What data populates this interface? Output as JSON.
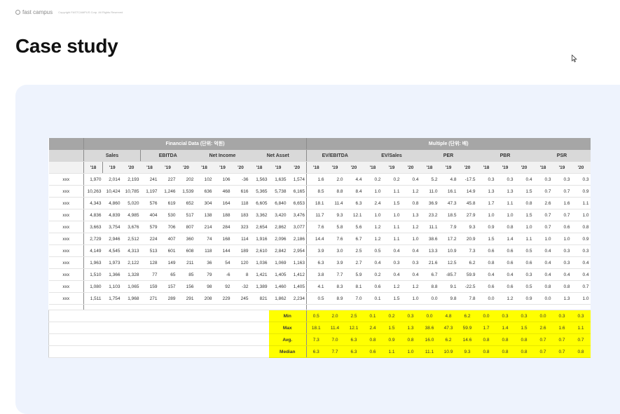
{
  "header": {
    "brand": "fast campus",
    "copyright": "Copyright FASTCAMPUS Corp. All Rights Reserved"
  },
  "page": {
    "title": "Case study"
  },
  "table": {
    "group_headers": {
      "financial": "Financial Data (단위: 억원)",
      "multiple": "Multiple (단위: 배)"
    },
    "metric_headers": [
      "Sales",
      "EBITDA",
      "Net Income",
      "Net Asset",
      "EV/EBITDA",
      "EV/Sales",
      "PER",
      "PBR",
      "PSR"
    ],
    "years": [
      "'18",
      "'19",
      "'20"
    ],
    "rows": [
      {
        "label": "xxx",
        "values": [
          "1,970",
          "2,014",
          "2,193",
          "241",
          "227",
          "202",
          "102",
          "106",
          "-36",
          "1,563",
          "1,635",
          "1,574",
          "1.6",
          "2.0",
          "4.4",
          "0.2",
          "0.2",
          "0.4",
          "5.2",
          "4.8",
          "-17.5",
          "0.3",
          "0.3",
          "0.4",
          "0.3",
          "0.3",
          "0.3"
        ]
      },
      {
        "label": "xxx",
        "values": [
          "10,263",
          "10,424",
          "10,785",
          "1,197",
          "1,246",
          "1,539",
          "636",
          "468",
          "616",
          "5,365",
          "5,738",
          "6,165",
          "8.5",
          "8.8",
          "8.4",
          "1.0",
          "1.1",
          "1.2",
          "11.0",
          "16.1",
          "14.9",
          "1.3",
          "1.3",
          "1.5",
          "0.7",
          "0.7",
          "0.9"
        ]
      },
      {
        "label": "xxx",
        "values": [
          "4,343",
          "4,860",
          "5,020",
          "576",
          "619",
          "652",
          "304",
          "164",
          "118",
          "6,605",
          "6,840",
          "6,653",
          "18.1",
          "11.4",
          "6.3",
          "2.4",
          "1.5",
          "0.8",
          "36.9",
          "47.3",
          "45.8",
          "1.7",
          "1.1",
          "0.8",
          "2.6",
          "1.6",
          "1.1"
        ]
      },
      {
        "label": "xxx",
        "values": [
          "4,836",
          "4,839",
          "4,985",
          "404",
          "530",
          "517",
          "138",
          "188",
          "183",
          "3,362",
          "3,420",
          "3,476",
          "11.7",
          "9.3",
          "12.1",
          "1.0",
          "1.0",
          "1.3",
          "23.2",
          "18.5",
          "27.9",
          "1.0",
          "1.0",
          "1.5",
          "0.7",
          "0.7",
          "1.0"
        ]
      },
      {
        "label": "xxx",
        "values": [
          "3,663",
          "3,754",
          "3,676",
          "579",
          "706",
          "807",
          "214",
          "284",
          "323",
          "2,654",
          "2,862",
          "3,077",
          "7.6",
          "5.8",
          "5.6",
          "1.2",
          "1.1",
          "1.2",
          "11.1",
          "7.9",
          "9.3",
          "0.9",
          "0.8",
          "1.0",
          "0.7",
          "0.6",
          "0.8"
        ]
      },
      {
        "label": "xxx",
        "values": [
          "2,729",
          "2,946",
          "2,512",
          "224",
          "407",
          "360",
          "74",
          "168",
          "114",
          "1,916",
          "2,096",
          "2,186",
          "14.4",
          "7.6",
          "6.7",
          "1.2",
          "1.1",
          "1.0",
          "38.6",
          "17.2",
          "20.9",
          "1.5",
          "1.4",
          "1.1",
          "1.0",
          "1.0",
          "0.9"
        ]
      },
      {
        "label": "xxx",
        "values": [
          "4,149",
          "4,545",
          "4,313",
          "513",
          "601",
          "608",
          "118",
          "144",
          "189",
          "2,610",
          "2,842",
          "2,954",
          "3.9",
          "3.0",
          "2.5",
          "0.5",
          "0.4",
          "0.4",
          "13.3",
          "10.9",
          "7.3",
          "0.6",
          "0.6",
          "0.5",
          "0.4",
          "0.3",
          "0.3"
        ]
      },
      {
        "label": "xxx",
        "values": [
          "1,963",
          "1,973",
          "2,122",
          "128",
          "149",
          "211",
          "36",
          "54",
          "120",
          "1,036",
          "1,069",
          "1,163",
          "6.3",
          "3.9",
          "2.7",
          "0.4",
          "0.3",
          "0.3",
          "21.6",
          "12.5",
          "6.2",
          "0.8",
          "0.6",
          "0.6",
          "0.4",
          "0.3",
          "0.4"
        ]
      },
      {
        "label": "xxx",
        "values": [
          "1,510",
          "1,366",
          "1,328",
          "77",
          "65",
          "85",
          "79",
          "-6",
          "8",
          "1,421",
          "1,405",
          "1,412",
          "3.8",
          "7.7",
          "5.9",
          "0.2",
          "0.4",
          "0.4",
          "6.7",
          "-85.7",
          "59.9",
          "0.4",
          "0.4",
          "0.3",
          "0.4",
          "0.4",
          "0.4"
        ]
      },
      {
        "label": "xxx",
        "values": [
          "1,080",
          "1,103",
          "1,065",
          "159",
          "157",
          "156",
          "98",
          "92",
          "-32",
          "1,389",
          "1,460",
          "1,405",
          "4.1",
          "8.3",
          "8.1",
          "0.6",
          "1.2",
          "1.2",
          "8.8",
          "9.1",
          "-22.5",
          "0.6",
          "0.6",
          "0.5",
          "0.8",
          "0.8",
          "0.7"
        ]
      },
      {
        "label": "xxx",
        "values": [
          "1,511",
          "1,754",
          "1,968",
          "271",
          "289",
          "291",
          "208",
          "229",
          "245",
          "821",
          "1,862",
          "2,234",
          "0.5",
          "8.9",
          "7.0",
          "0.1",
          "1.5",
          "1.0",
          "0.0",
          "9.8",
          "7.8",
          "0.0",
          "1.2",
          "0.9",
          "0.0",
          "1.3",
          "1.0"
        ]
      }
    ],
    "stats": [
      {
        "label": "Min",
        "values": [
          "0.5",
          "2.0",
          "2.5",
          "0.1",
          "0.2",
          "0.3",
          "0.0",
          "4.8",
          "6.2",
          "0.0",
          "0.3",
          "0.3",
          "0.0",
          "0.3",
          "0.3"
        ]
      },
      {
        "label": "Max",
        "values": [
          "18.1",
          "11.4",
          "12.1",
          "2.4",
          "1.5",
          "1.3",
          "38.6",
          "47.3",
          "59.9",
          "1.7",
          "1.4",
          "1.5",
          "2.6",
          "1.6",
          "1.1"
        ]
      },
      {
        "label": "Avg.",
        "values": [
          "7.3",
          "7.0",
          "6.3",
          "0.8",
          "0.9",
          "0.8",
          "16.0",
          "6.2",
          "14.6",
          "0.8",
          "0.8",
          "0.8",
          "0.7",
          "0.7",
          "0.7"
        ]
      },
      {
        "label": "Median",
        "values": [
          "6.3",
          "7.7",
          "6.3",
          "0.6",
          "1.1",
          "1.0",
          "11.1",
          "10.9",
          "9.3",
          "0.8",
          "0.8",
          "0.8",
          "0.7",
          "0.7",
          "0.8"
        ]
      }
    ]
  }
}
